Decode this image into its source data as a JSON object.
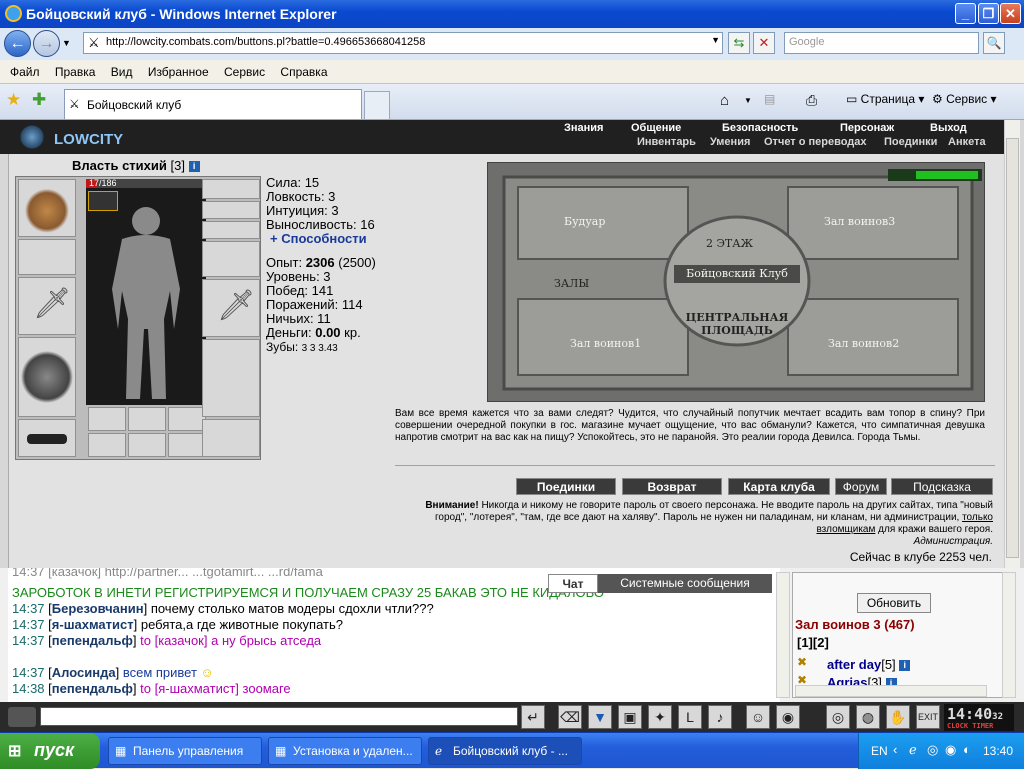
{
  "window": {
    "title": "Бойцовский клуб - Windows Internet Explorer"
  },
  "address": {
    "url": "http://lowcity.combats.com/buttons.pl?battle=0.496653668041258",
    "search_placeholder": "Google"
  },
  "menu": [
    "Файл",
    "Правка",
    "Вид",
    "Избранное",
    "Сервис",
    "Справка"
  ],
  "tab": {
    "title": "Бойцовский клуб"
  },
  "toolbar_right": {
    "page": "Страница",
    "service": "Сервис"
  },
  "game": {
    "logo": "LOWCITY",
    "nav1": [
      "Знания",
      "Общение",
      "Безопасность",
      "Персонаж",
      "Выход"
    ],
    "nav2": [
      "Инвентарь",
      "Умения",
      "Отчет о переводах",
      "Поединки",
      "Анкета"
    ],
    "char_name": "Власть стихий",
    "char_level": "[3]",
    "hp": "17/186",
    "hp_fraction": 0.091,
    "stats": [
      "Сила: 15",
      "Ловкость: 3",
      "Интуиция: 3",
      "Выносливость: 16"
    ],
    "abilities_link": "+ Способности",
    "exp_label": "Опыт:",
    "exp_value": "2306",
    "exp_next": "(2500)",
    "level": "Уровень: 3",
    "wins": "Побед: 141",
    "losses": "Поражений: 114",
    "draws": "Ничьих: 11",
    "money_label": "Деньги:",
    "money_value": "0.00",
    "money_unit": "кр.",
    "teeth_label": "Зубы:",
    "teeth_values": "3 3 3.43",
    "map": {
      "boudoir": "Будуар",
      "hall3": "Зал воинов3",
      "floor2": "2 ЭТАЖ",
      "club": "Бойцовский Клуб",
      "halls": "ЗАЛЫ",
      "center": "ЦЕНТРАЛЬНАЯ ПЛОЩАДЬ",
      "hall1": "Зал воинов1",
      "hall2": "Зал воинов2"
    },
    "flavor": "Вам все время кажется что за вами следят? Чудится, что случайный попутчик мечтает всадить вам топор в спину? При совершении очередной покупки в гос. магазине мучает ощущение, что вас обманули? Кажется, что симпатичная девушка напротив смотрит на вас как на пищу? Успокойтесь, это не паранойя. Это реалии города Девилса. Города Тьмы.",
    "buttons": [
      "Поединки",
      "Возврат",
      "Карта клуба",
      "Форум",
      "Подсказка"
    ],
    "warning_bold": "Внимание!",
    "warning_text": "Никогда и никому не говорите пароль от своего персонажа. Не вводите пароль на других сайтах, типа \"новый город\", \"лотерея\", \"там, где все дают на халяву\". Пароль не нужен ни паладинам, ни кланам, ни администрации,",
    "warning_link": "только взломщикам",
    "warning_end": "для кражи вашего героя.",
    "admin": "Администрация.",
    "online": "Сейчас в клубе 2253 чел."
  },
  "chat": {
    "tab_chat": "Чат",
    "tab_system": "Системные сообщения",
    "partial_top": "14:37 [казачок] http://partner... ...tgotamirt... ...rd/fama",
    "green_line": "ЗАРОБОТОК В ИНЕТИ РЕГИСТРИРУЕМСЯ И ПОЛУЧАЕМ СРАЗУ 25 БАКАВ ЭТО НЕ КИДАЛОВО",
    "messages": [
      {
        "time": "14:37",
        "user": "Березовчанин",
        "text": "почему столько матов модеры сдохли чтли???",
        "to": ""
      },
      {
        "time": "14:37",
        "user": "я-шахматист",
        "text": "ребята,а где животные покупать?",
        "to": ""
      },
      {
        "time": "14:37",
        "user": "пепендальф",
        "text": "а ну брысь атседа",
        "to": "to [казачок]"
      },
      {
        "time": "14:37",
        "user": "Алосинда",
        "text": "всем привет",
        "to": ""
      },
      {
        "time": "14:38",
        "user": "пепендальф",
        "text": "зоомаге",
        "to": "to [я-шахматист]"
      }
    ]
  },
  "room": {
    "refresh": "Обновить",
    "title": "Зал воинов 3 (467)",
    "pages": "[1][2]",
    "players": [
      {
        "name": "after day",
        "level": "[5]"
      },
      {
        "name": "Agrias",
        "level": "[3]"
      }
    ]
  },
  "clock": {
    "time": "14:40",
    "sec": "32",
    "labels": "CLOCK TIMER"
  },
  "taskbar": {
    "start": "пуск",
    "items": [
      "Панель управления",
      "Установка и удален...",
      "Бойцовский клуб - ..."
    ],
    "lang": "EN",
    "time": "13:40"
  },
  "colors": {
    "titlebar": "#0a4ad0",
    "game_header": "#202020",
    "room_title": "#8b0000",
    "player": "#00008b",
    "chat_green": "#1a8a1a",
    "chat_private": "#b000b0"
  }
}
